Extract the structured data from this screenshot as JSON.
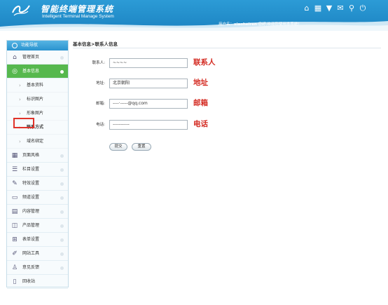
{
  "header": {
    "title_cn": "智能终端管理系统",
    "title_en": "Intelligent  Terminal  Manage  System",
    "icons": [
      "home-icon",
      "grid-icon",
      "shirt-icon",
      "mail-icon",
      "user-icon",
      "power-icon"
    ],
    "user_prefix": "用户名：",
    "username": "xiaoheiren",
    "greeting": " 您好,欢迎您使用本系统!"
  },
  "sidebar": {
    "title": "功能导航",
    "items": [
      {
        "label": "管理首页",
        "icon": "home-icon"
      },
      {
        "label": "基本信息",
        "icon": "info-icon",
        "active": true
      },
      {
        "label": "页面风格",
        "icon": "layout-icon"
      },
      {
        "label": "栏目设置",
        "icon": "list-icon"
      },
      {
        "label": "特效设置",
        "icon": "wand-icon"
      },
      {
        "label": "频道设置",
        "icon": "channel-icon"
      },
      {
        "label": "内容管理",
        "icon": "content-icon"
      },
      {
        "label": "产品管理",
        "icon": "bag-icon"
      },
      {
        "label": "表单设置",
        "icon": "cart-icon"
      },
      {
        "label": "网站工具",
        "icon": "tool-icon"
      },
      {
        "label": "意见反馈",
        "icon": "person-icon"
      },
      {
        "label": "回收站",
        "icon": "trash-icon"
      }
    ],
    "subitems": [
      "基本资料",
      "标识图片",
      "形象图片",
      "联系方式",
      "域名绑定"
    ]
  },
  "main": {
    "breadcrumb": "基本信息>联系人信息",
    "fields": [
      {
        "label": "联系人:",
        "value": "~~~~",
        "note": "联系人"
      },
      {
        "label": "地址:",
        "value": "北京朝阳",
        "note": "地址"
      },
      {
        "label": "邮箱:",
        "value": "----·-----@qq.com",
        "note": "邮箱"
      },
      {
        "label": "电话:",
        "value": "-----------",
        "note": "电话"
      }
    ],
    "submit_label": "提交",
    "reset_label": "重置"
  }
}
